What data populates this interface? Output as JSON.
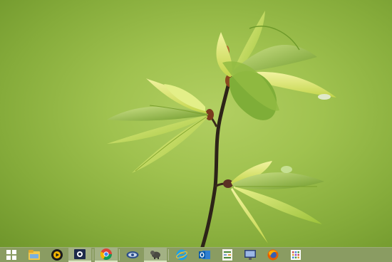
{
  "desktop": {
    "wallpaper": "green-leaves-sprig"
  },
  "taskbar": {
    "background": "#8a9c62",
    "items": [
      {
        "name": "start-button",
        "icon": "windows-logo-icon",
        "state": "normal"
      },
      {
        "name": "file-explorer-button",
        "icon": "folder-icon",
        "state": "normal"
      },
      {
        "name": "media-player-button",
        "icon": "media-player-icon",
        "state": "normal"
      },
      {
        "name": "camera-app-button",
        "icon": "camera-icon",
        "state": "active"
      },
      {
        "name": "chrome-button",
        "icon": "chrome-icon",
        "state": "active"
      },
      {
        "name": "network-app-button",
        "icon": "network-eye-icon",
        "state": "normal"
      },
      {
        "name": "animal-app-button",
        "icon": "animal-icon",
        "state": "active"
      },
      {
        "name": "internet-explorer-button",
        "icon": "ie-icon",
        "state": "normal"
      },
      {
        "name": "outlook-button",
        "icon": "outlook-icon",
        "state": "normal"
      },
      {
        "name": "spreadsheet-app-button",
        "icon": "spreadsheet-icon",
        "state": "normal"
      },
      {
        "name": "screen-app-button",
        "icon": "monitor-icon",
        "state": "normal"
      },
      {
        "name": "firefox-button",
        "icon": "firefox-icon",
        "state": "normal"
      },
      {
        "name": "apps-grid-button",
        "icon": "apps-grid-icon",
        "state": "normal"
      }
    ]
  }
}
